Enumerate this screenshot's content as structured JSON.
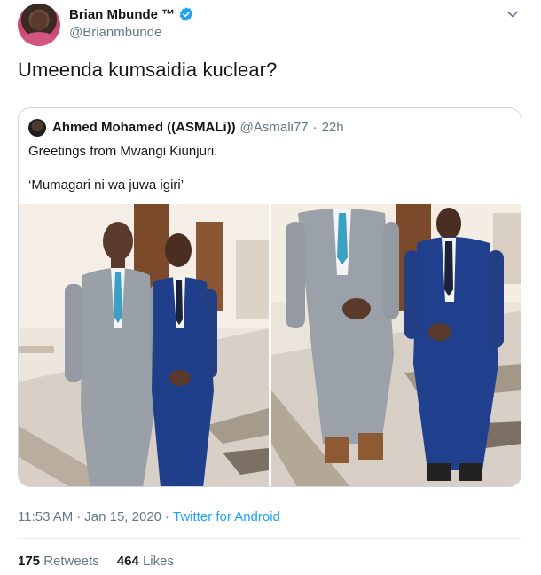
{
  "author": {
    "name": "Brian Mbunde ™",
    "handle": "@Brianmbunde",
    "verified": true
  },
  "tweet": {
    "text": "Umeenda kumsaidia kuclear?"
  },
  "quoted_tweet": {
    "name": "Ahmed Mohamed ((ASMALi))",
    "handle": "@Asmali77",
    "separator": "·",
    "time": "22h",
    "line1": "Greetings from Mwangi Kiunjuri.",
    "line2": "‘Mumagari ni wa juwa igiri’"
  },
  "meta": {
    "time": "11:53 AM",
    "separator": "·",
    "date": "Jan 15, 2020",
    "separator2": "·",
    "source": "Twitter for Android"
  },
  "stats": {
    "retweets_count": "175",
    "retweets_label": "Retweets",
    "likes_count": "464",
    "likes_label": "Likes"
  },
  "colors": {
    "accent": "#1da1f2",
    "text_primary": "#14171a",
    "text_secondary": "#657786",
    "border": "#ccd6dd"
  },
  "icons": {
    "verified": "verified-badge-icon",
    "menu": "chevron-down-icon"
  }
}
